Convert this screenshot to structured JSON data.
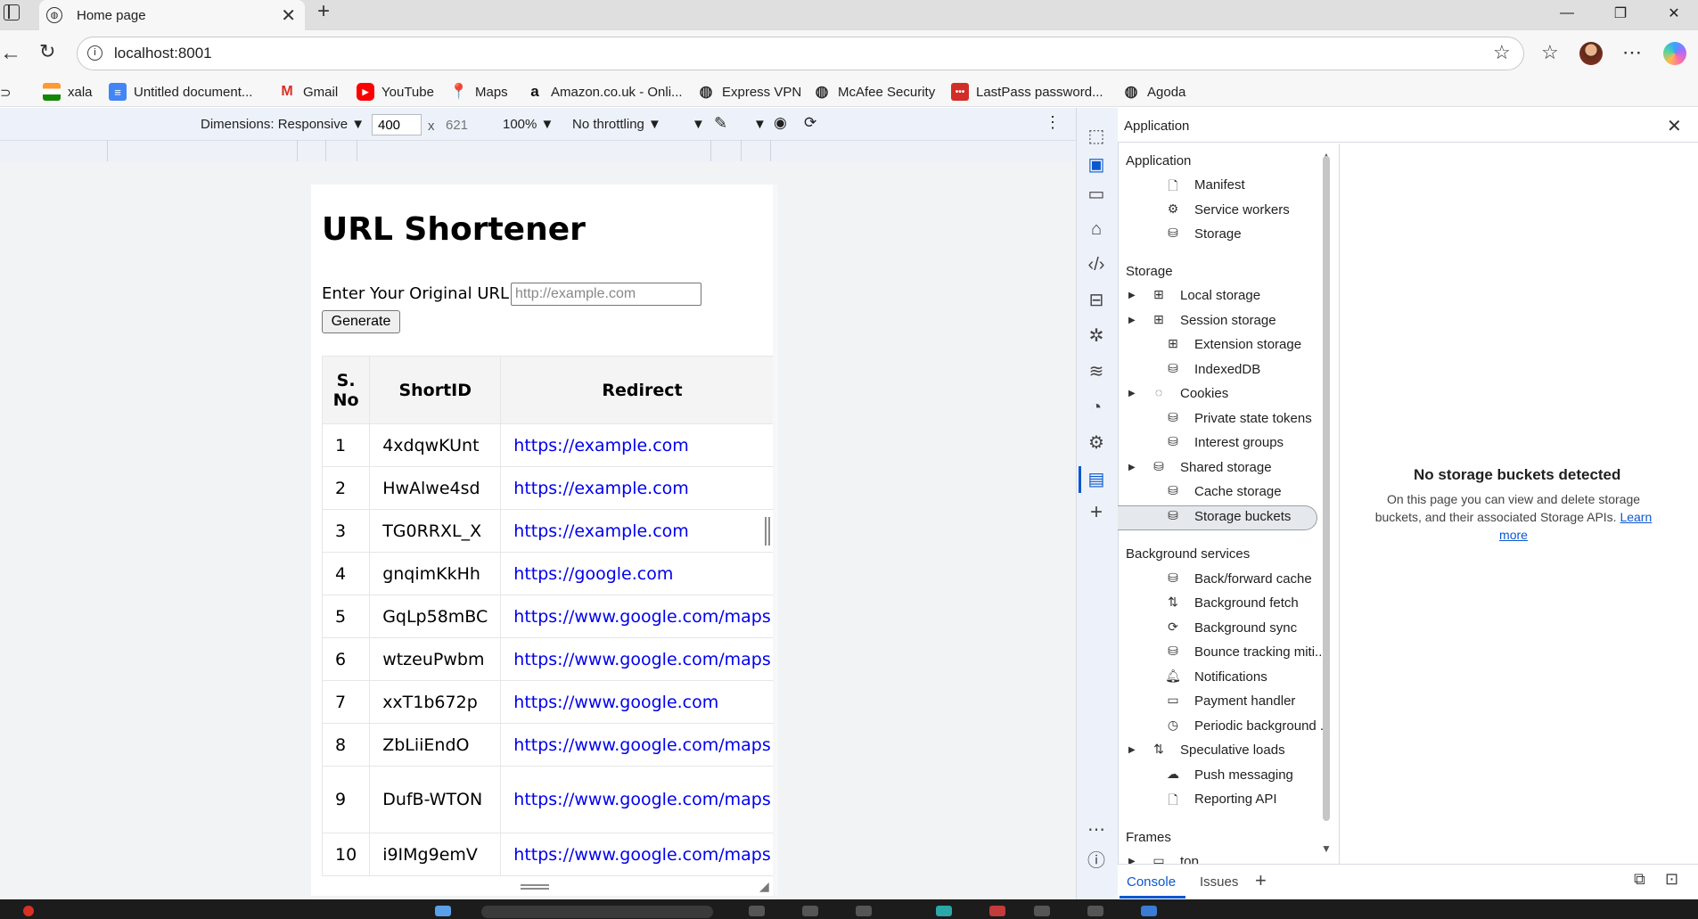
{
  "browser": {
    "tab_title": "Home page",
    "tab_close": "✕",
    "new_tab": "+",
    "url": "localhost:8001",
    "bookmarks": [
      {
        "label": "xala",
        "icon": "flag-india-icon"
      },
      {
        "label": "Untitled document...",
        "icon": "google-docs-icon"
      },
      {
        "label": "Gmail",
        "icon": "gmail-icon"
      },
      {
        "label": "YouTube",
        "icon": "youtube-icon"
      },
      {
        "label": "Maps",
        "icon": "google-maps-icon"
      },
      {
        "label": "Amazon.co.uk - Onli...",
        "icon": "amazon-icon"
      },
      {
        "label": "Express VPN",
        "icon": "globe-icon"
      },
      {
        "label": "McAfee Security",
        "icon": "globe-icon"
      },
      {
        "label": "LastPass password...",
        "icon": "lastpass-icon"
      },
      {
        "label": "Agoda",
        "icon": "globe-icon"
      }
    ]
  },
  "device_toolbar": {
    "dimensions": "Dimensions: Responsive",
    "width": "400",
    "times": "x",
    "height_placeholder": "621",
    "zoom": "100%",
    "throttling": "No throttling"
  },
  "page": {
    "heading": "URL Shortener",
    "input_label": "Enter Your Original URL",
    "input_placeholder": "http://example.com",
    "button_label": "Generate",
    "table": {
      "headers": [
        "S. No",
        "ShortID",
        "Redirect"
      ],
      "rows": [
        [
          "1",
          "4xdqwKUnt",
          "https://example.com"
        ],
        [
          "2",
          "HwAlwe4sd",
          "https://example.com"
        ],
        [
          "3",
          "TG0RRXL_X",
          "https://example.com"
        ],
        [
          "4",
          "gnqimKkHh",
          "https://google.com"
        ],
        [
          "5",
          "GqLp58mBC",
          "https://www.google.com/maps"
        ],
        [
          "6",
          "wtzeuPwbm",
          "https://www.google.com/maps"
        ],
        [
          "7",
          "xxT1b672p",
          "https://www.google.com"
        ],
        [
          "8",
          "ZbLiiEndO",
          "https://www.google.com/maps"
        ],
        [
          "9",
          "DufB-WTON",
          "https://www.google.com/maps"
        ],
        [
          "10",
          "i9IMg9emV",
          "https://www.google.com/maps"
        ]
      ]
    }
  },
  "devtools": {
    "panel_title": "Application",
    "sections": [
      {
        "title": "Application",
        "items": [
          {
            "label": "Manifest",
            "icon": "document-icon",
            "expandable": false
          },
          {
            "label": "Service workers",
            "icon": "gear-document-icon",
            "expandable": false
          },
          {
            "label": "Storage",
            "icon": "database-icon",
            "expandable": false
          }
        ]
      },
      {
        "title": "Storage",
        "items": [
          {
            "label": "Local storage",
            "icon": "grid-icon",
            "expandable": true
          },
          {
            "label": "Session storage",
            "icon": "grid-icon",
            "expandable": true
          },
          {
            "label": "Extension storage",
            "icon": "grid-icon",
            "expandable": false
          },
          {
            "label": "IndexedDB",
            "icon": "database-icon",
            "expandable": false
          },
          {
            "label": "Cookies",
            "icon": "cookie-icon",
            "expandable": true
          },
          {
            "label": "Private state tokens",
            "icon": "database-icon",
            "expandable": false
          },
          {
            "label": "Interest groups",
            "icon": "database-icon",
            "expandable": false
          },
          {
            "label": "Shared storage",
            "icon": "database-icon",
            "expandable": true
          },
          {
            "label": "Cache storage",
            "icon": "database-icon",
            "expandable": false
          },
          {
            "label": "Storage buckets",
            "icon": "database-icon",
            "expandable": false
          }
        ]
      },
      {
        "title": "Background services",
        "items": [
          {
            "label": "Back/forward cache",
            "icon": "database-icon",
            "expandable": false
          },
          {
            "label": "Background fetch",
            "icon": "arrows-updown-icon",
            "expandable": false
          },
          {
            "label": "Background sync",
            "icon": "sync-icon",
            "expandable": false
          },
          {
            "label": "Bounce tracking miti...",
            "icon": "database-icon",
            "expandable": false
          },
          {
            "label": "Notifications",
            "icon": "bell-icon",
            "expandable": false
          },
          {
            "label": "Payment handler",
            "icon": "card-icon",
            "expandable": false
          },
          {
            "label": "Periodic background ...",
            "icon": "clock-icon",
            "expandable": false
          },
          {
            "label": "Speculative loads",
            "icon": "arrows-updown-icon",
            "expandable": true
          },
          {
            "label": "Push messaging",
            "icon": "cloud-icon",
            "expandable": false
          },
          {
            "label": "Reporting API",
            "icon": "document-icon",
            "expandable": false
          }
        ]
      },
      {
        "title": "Frames",
        "items": [
          {
            "label": "top",
            "icon": "frame-icon",
            "expandable": true
          }
        ]
      }
    ],
    "empty_state": {
      "title": "No storage buckets detected",
      "description": "On this page you can view and delete storage buckets, and their associated Storage APIs.",
      "link": "Learn more"
    },
    "drawer_tabs": [
      "Console",
      "Issues"
    ]
  }
}
